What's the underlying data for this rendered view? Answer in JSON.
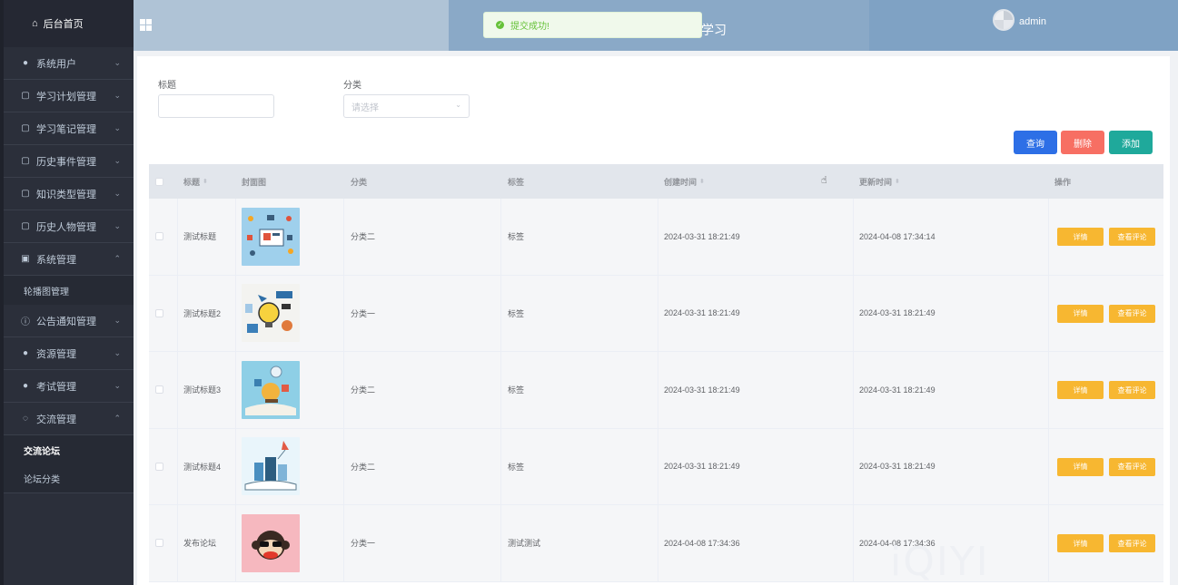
{
  "sidebar": {
    "home_label": "后台首页",
    "items": [
      {
        "label": "系统用户",
        "icon": "user-icon",
        "chev": "⌄"
      },
      {
        "label": "学习计划管理",
        "icon": "doc-icon",
        "chev": "⌄"
      },
      {
        "label": "学习笔记管理",
        "icon": "doc-icon",
        "chev": "⌄"
      },
      {
        "label": "历史事件管理",
        "icon": "doc-icon",
        "chev": "⌄"
      },
      {
        "label": "知识类型管理",
        "icon": "doc-icon",
        "chev": "⌄"
      },
      {
        "label": "历史人物管理",
        "icon": "doc-icon",
        "chev": "⌄"
      },
      {
        "label": "系统管理",
        "icon": "picture-icon",
        "chev": "⌃"
      },
      {
        "label": "公告通知管理",
        "icon": "info-icon",
        "chev": "⌄"
      },
      {
        "label": "资源管理",
        "icon": "location-icon",
        "chev": "⌄"
      },
      {
        "label": "考试管理",
        "icon": "location-icon",
        "chev": "⌄"
      },
      {
        "label": "交流管理",
        "icon": "chat-icon",
        "chev": "⌃"
      }
    ],
    "sub_system": "轮播图管理",
    "sub_forum": [
      "交流论坛",
      "论坛分类"
    ]
  },
  "header": {
    "title_fragment": "学习",
    "username": "admin"
  },
  "toast": {
    "message": "提交成功!"
  },
  "filters": {
    "title_label": "标题",
    "title_value": "",
    "category_label": "分类",
    "category_placeholder": "请选择"
  },
  "buttons": {
    "query": "查询",
    "delete": "删除",
    "add": "添加"
  },
  "colors": {
    "query": "#2d6fe6",
    "delete": "#f76f63",
    "add": "#1fa99b",
    "row_button": "#f7b731"
  },
  "table": {
    "columns": [
      "标题",
      "封面图",
      "分类",
      "标签",
      "创建时间",
      "更新时间",
      "操作"
    ],
    "rows": [
      {
        "title": "测试标题",
        "category": "分类二",
        "tag": "标签",
        "created": "2024-03-31 18:21:49",
        "updated": "2024-04-08 17:34:14",
        "detail": "详情",
        "comment": "查看评论"
      },
      {
        "title": "测试标题2",
        "category": "分类一",
        "tag": "标签",
        "created": "2024-03-31 18:21:49",
        "updated": "2024-03-31 18:21:49",
        "detail": "详情",
        "comment": "查看评论"
      },
      {
        "title": "测试标题3",
        "category": "分类二",
        "tag": "标签",
        "created": "2024-03-31 18:21:49",
        "updated": "2024-03-31 18:21:49",
        "detail": "详情",
        "comment": "查看评论"
      },
      {
        "title": "测试标题4",
        "category": "分类二",
        "tag": "标签",
        "created": "2024-03-31 18:21:49",
        "updated": "2024-03-31 18:21:49",
        "detail": "详情",
        "comment": "查看评论"
      },
      {
        "title": "发布论坛",
        "category": "分类一",
        "tag": "测试测试",
        "created": "2024-04-08 17:34:36",
        "updated": "2024-04-08 17:34:36",
        "detail": "详情",
        "comment": "查看评论"
      }
    ]
  },
  "watermark": "iQIYI"
}
